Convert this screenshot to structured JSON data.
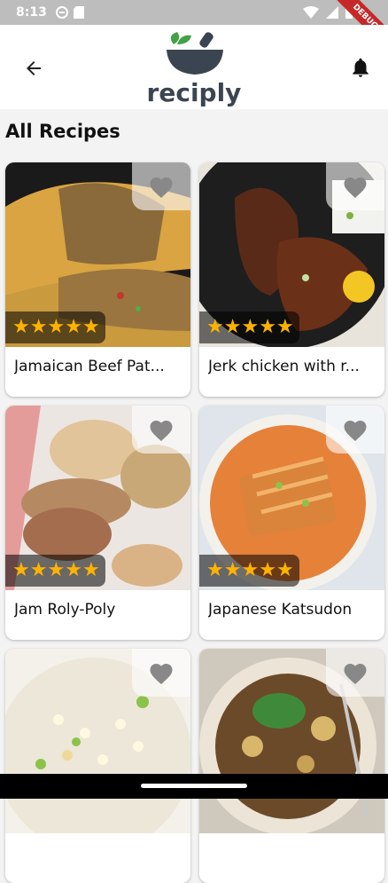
{
  "status": {
    "time": "8:13"
  },
  "debug_banner": "DEBUG",
  "header": {
    "logo_text": "reciply"
  },
  "section_title": "All Recipes",
  "recipes": [
    {
      "title": "Jamaican Beef Pat...",
      "rating": 5
    },
    {
      "title": "Jerk chicken with r...",
      "rating": 5
    },
    {
      "title": "Jam Roly-Poly",
      "rating": 5
    },
    {
      "title": "Japanese Katsudon",
      "rating": 5
    },
    {
      "title": "",
      "rating": null
    },
    {
      "title": "",
      "rating": null
    }
  ],
  "colors": {
    "accent_star": "#ffb300",
    "logo_green": "#43a047",
    "logo_bowl": "#3b4552"
  }
}
